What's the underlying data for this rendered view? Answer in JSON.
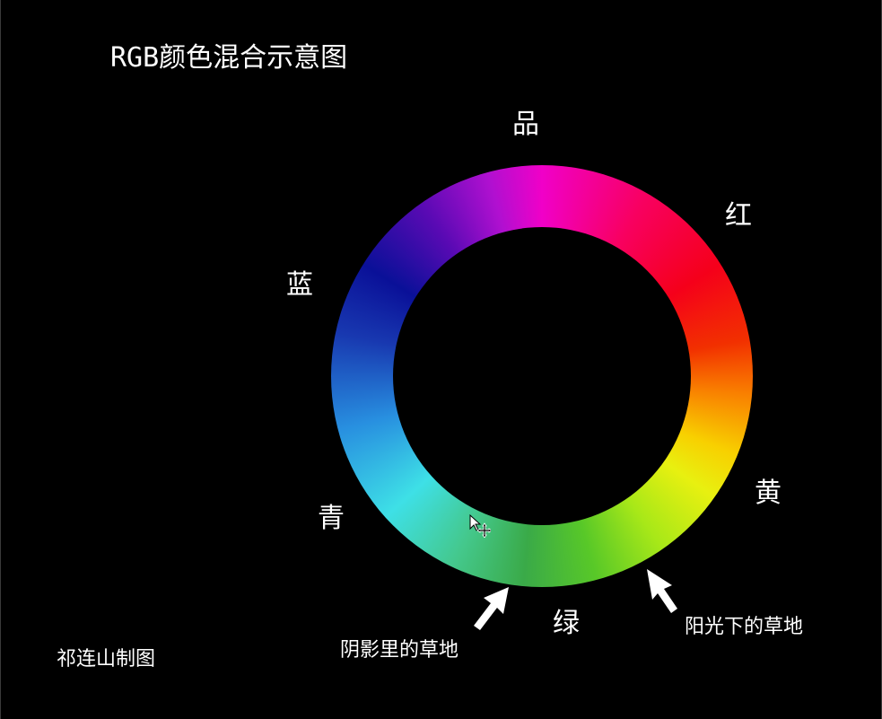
{
  "title": "RGB颜色混合示意图",
  "labels": {
    "magenta": "品",
    "red": "红",
    "blue": "蓝",
    "yellow": "黄",
    "cyan": "青",
    "green": "绿"
  },
  "annotations": {
    "shadow_grass": "阴影里的草地",
    "sunlit_grass": "阳光下的草地"
  },
  "credit": "祁连山制图",
  "colors": {
    "background": "#000000",
    "text": "#ffffff",
    "magenta": "#f000c8",
    "red": "#f5001a",
    "yellow": "#e8f010",
    "green": "#3aaa48",
    "cyan": "#3ee0e6",
    "blue": "#0a1098"
  }
}
